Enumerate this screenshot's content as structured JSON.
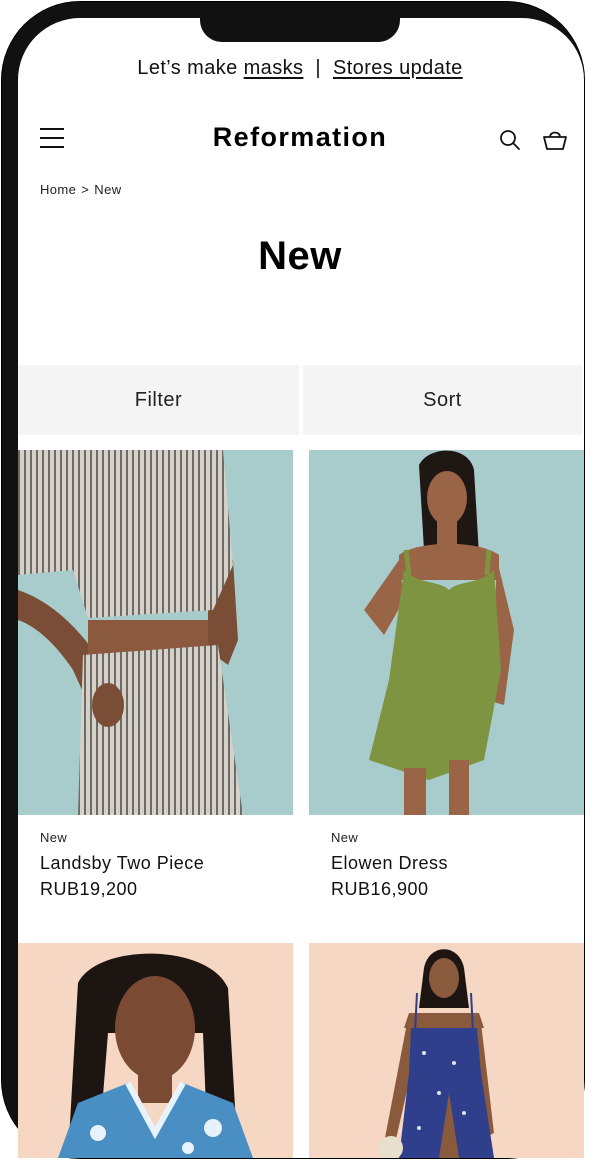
{
  "promo": {
    "prefix": "Let’s make",
    "link_masks": "masks",
    "separator": "|",
    "link_stores": "Stores update"
  },
  "header": {
    "brand": "Reformation"
  },
  "breadcrumb": {
    "home": "Home",
    "separator": ">",
    "current": "New"
  },
  "page": {
    "title": "New"
  },
  "controls": {
    "filter_label": "Filter",
    "sort_label": "Sort"
  },
  "products": [
    {
      "badge": "New",
      "name": "Landsby Two Piece",
      "price": "RUB19,200"
    },
    {
      "badge": "New",
      "name": "Elowen Dress",
      "price": "RUB16,900"
    }
  ],
  "colors": {
    "photo_bg_blue": "#a8cccc",
    "photo_bg_peach": "#f5d7c4",
    "dress_green": "#7e9440",
    "dress_navy": "#2f3f8c"
  },
  "icons": [
    "hamburger-menu-icon",
    "search-icon",
    "shopping-bag-icon"
  ]
}
